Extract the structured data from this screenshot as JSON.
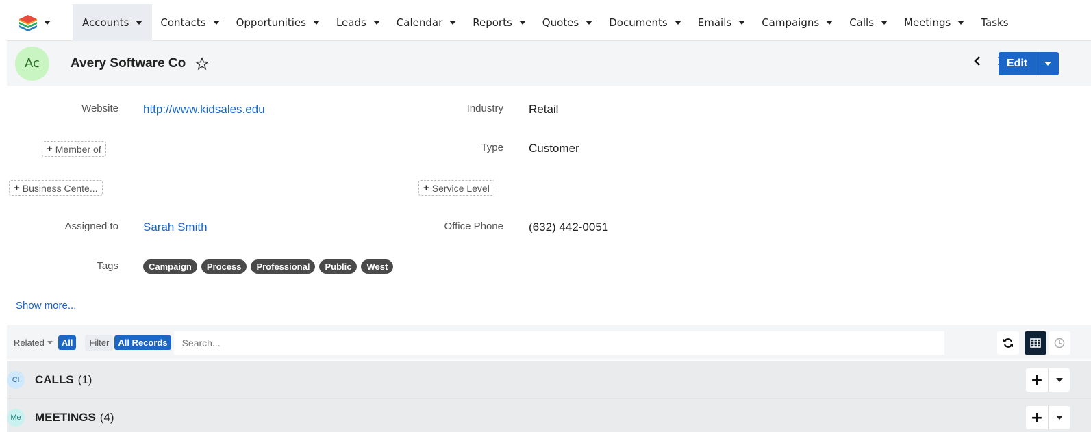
{
  "nav": {
    "logo_icon": "stack-logo-icon",
    "items": [
      {
        "label": "Accounts"
      },
      {
        "label": "Contacts"
      },
      {
        "label": "Opportunities"
      },
      {
        "label": "Leads"
      },
      {
        "label": "Calendar"
      },
      {
        "label": "Reports"
      },
      {
        "label": "Quotes"
      },
      {
        "label": "Documents"
      },
      {
        "label": "Emails"
      },
      {
        "label": "Campaigns"
      },
      {
        "label": "Calls"
      },
      {
        "label": "Meetings"
      },
      {
        "label": "Tasks"
      }
    ]
  },
  "record": {
    "avatar": "Ac",
    "name": "Avery Software Co",
    "edit_label": "Edit"
  },
  "fields": {
    "website_label": "Website",
    "website_value": "http://www.kidsales.edu",
    "industry_label": "Industry",
    "industry_value": "Retail",
    "member_of_btn": "Member of",
    "type_label": "Type",
    "type_value": "Customer",
    "business_center_btn": "Business Cente...",
    "service_level_btn": "Service Level",
    "assigned_label": "Assigned to",
    "assigned_value": "Sarah Smith",
    "office_phone_label": "Office Phone",
    "office_phone_value": "(632) 442-0051",
    "tags_label": "Tags",
    "tags": [
      "Campaign",
      "Process",
      "Professional",
      "Public",
      "West"
    ],
    "show_more": "Show more..."
  },
  "related": {
    "related_label": "Related",
    "related_value": "All",
    "filter_label": "Filter",
    "filter_value": "All Records",
    "search_placeholder": "Search..."
  },
  "subpanels": [
    {
      "icon": "Cl",
      "title": "CALLS",
      "count": "(1)",
      "icon_bg": "#cfe8fb",
      "icon_fg": "#2a6aa8"
    },
    {
      "icon": "Me",
      "title": "MEETINGS",
      "count": "(4)",
      "icon_bg": "#c8f1ef",
      "icon_fg": "#24807a"
    }
  ],
  "colors": {
    "accent": "#1b66c7",
    "tag_bg": "#4a4a4a"
  }
}
